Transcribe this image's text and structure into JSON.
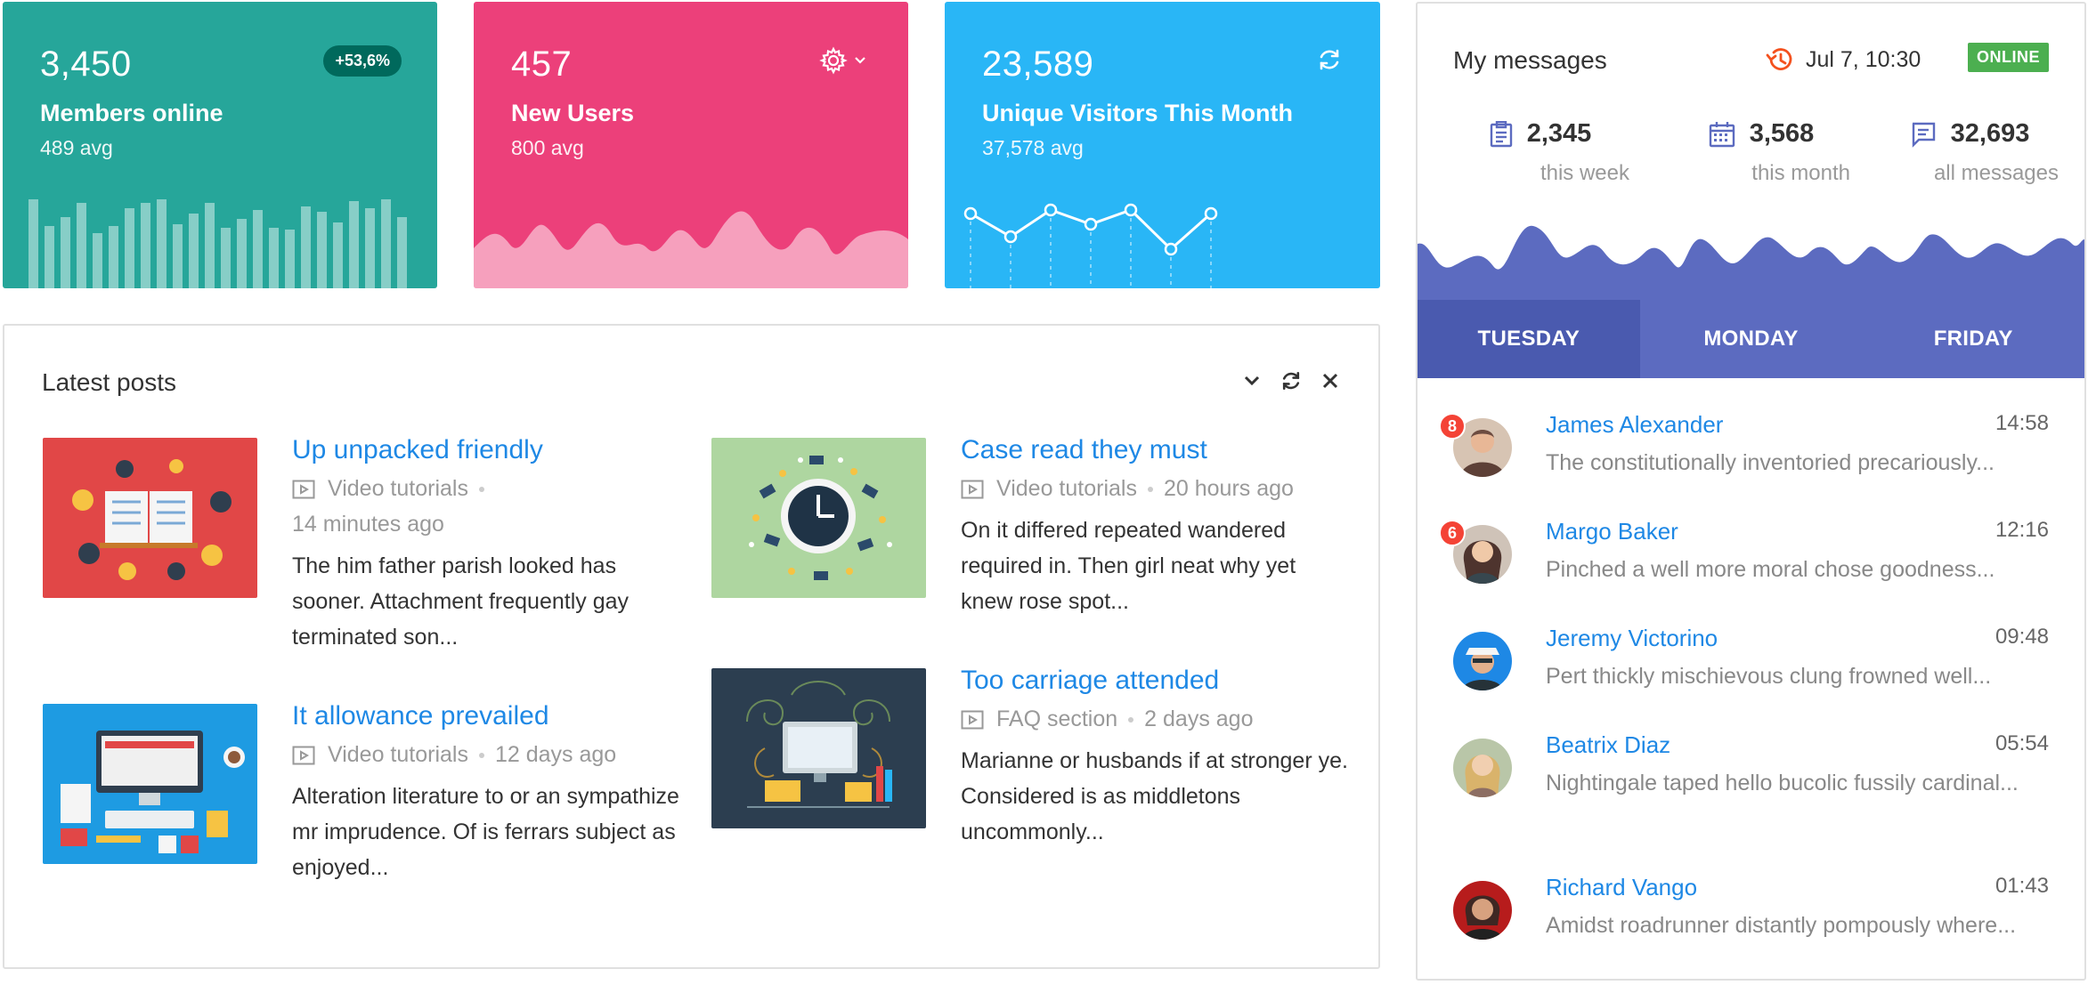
{
  "stats": [
    {
      "value": "3,450",
      "label": "Members online",
      "avg": "489 avg",
      "badge": "+53,6%",
      "color": "#26a69a"
    },
    {
      "value": "457",
      "label": "New Users",
      "avg": "800 avg",
      "color": "#ec407a",
      "icon": "gear-icon"
    },
    {
      "value": "23,589",
      "label": "Unique Visitors This Month",
      "avg": "37,578 avg",
      "color": "#29b6f6",
      "icon": "refresh-icon"
    }
  ],
  "posts": {
    "title": "Latest posts",
    "items": [
      {
        "title": "Up unpacked friendly",
        "category": "Video tutorials",
        "time": "14 minutes ago",
        "text": "The him father parish looked has sooner. Attachment frequently gay terminated son..."
      },
      {
        "title": "Case read they must",
        "category": "Video tutorials",
        "time": "20 hours ago",
        "text": "On it differed repeated wandered required in. Then girl neat why yet knew rose spot..."
      },
      {
        "title": "It allowance prevailed",
        "category": "Video tutorials",
        "time": "12 days ago",
        "text": "Alteration literature to or an sympathize mr imprudence. Of is ferrars subject as enjoyed..."
      },
      {
        "title": "Too carriage attended",
        "category": "FAQ section",
        "time": "2 days ago",
        "text": "Marianne or husbands if at stronger ye. Considered is as middletons uncommonly..."
      }
    ]
  },
  "messages": {
    "title": "My messages",
    "datetime": "Jul 7, 10:30",
    "status": "ONLINE",
    "stats": [
      {
        "value": "2,345",
        "label": "this week"
      },
      {
        "value": "3,568",
        "label": "this month"
      },
      {
        "value": "32,693",
        "label": "all messages"
      }
    ],
    "tabs": [
      "TUESDAY",
      "MONDAY",
      "FRIDAY"
    ],
    "active_tab": "TUESDAY",
    "items": [
      {
        "name": "James Alexander",
        "time": "14:58",
        "preview": "The constitutionally inventoried precariously...",
        "badge": "8"
      },
      {
        "name": "Margo Baker",
        "time": "12:16",
        "preview": "Pinched a well more moral chose goodness...",
        "badge": "6"
      },
      {
        "name": "Jeremy Victorino",
        "time": "09:48",
        "preview": "Pert thickly mischievous clung frowned well..."
      },
      {
        "name": "Beatrix Diaz",
        "time": "05:54",
        "preview": "Nightingale taped hello bucolic fussily cardinal..."
      },
      {
        "name": "Richard Vango",
        "time": "01:43",
        "preview": "Amidst roadrunner distantly pompously where..."
      }
    ]
  }
}
